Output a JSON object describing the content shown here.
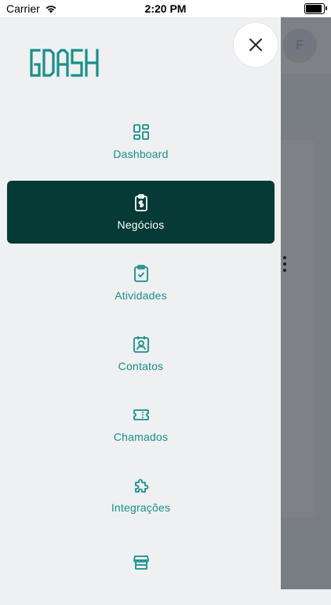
{
  "status_bar": {
    "carrier": "Carrier",
    "time": "2:20 PM"
  },
  "background": {
    "avatar_initial": "F"
  },
  "brand": {
    "logo_text": "GDASH",
    "accent_color": "#1a8f8a",
    "active_bg": "#053a36"
  },
  "menu": {
    "items": [
      {
        "label": "Dashboard",
        "icon": "dashboard-grid-icon",
        "active": false
      },
      {
        "label": "Negócios",
        "icon": "clipboard-dollar-icon",
        "active": true
      },
      {
        "label": "Atividades",
        "icon": "clipboard-check-icon",
        "active": false
      },
      {
        "label": "Contatos",
        "icon": "contact-card-icon",
        "active": false
      },
      {
        "label": "Chamados",
        "icon": "ticket-icon",
        "active": false
      },
      {
        "label": "Integrações",
        "icon": "puzzle-icon",
        "active": false
      },
      {
        "label": "",
        "icon": "store-icon",
        "active": false
      }
    ]
  }
}
